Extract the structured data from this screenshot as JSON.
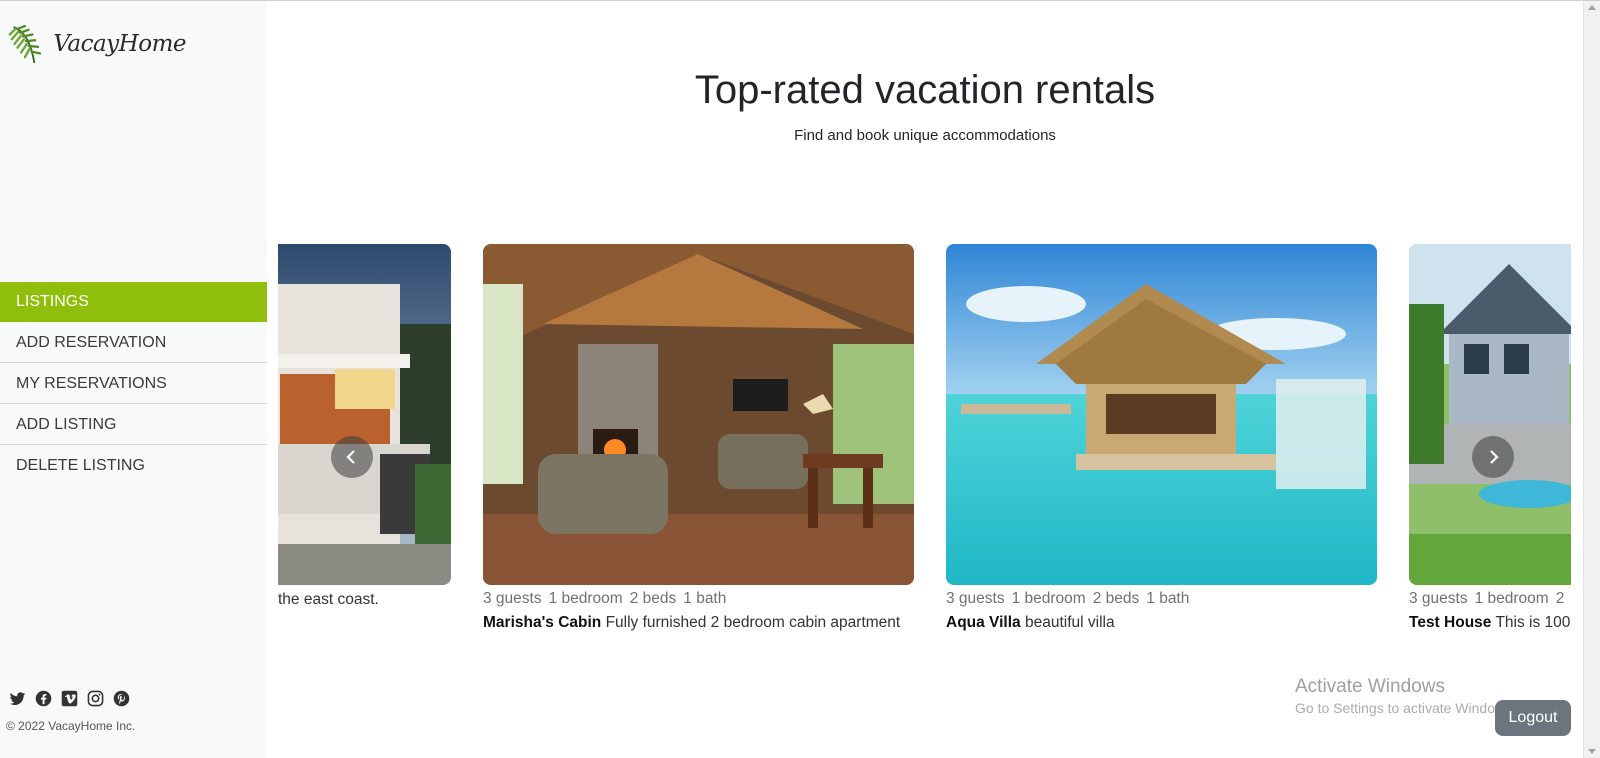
{
  "brand": {
    "name": "VacayHome"
  },
  "nav": [
    {
      "label": "LISTINGS",
      "active": true
    },
    {
      "label": "ADD RESERVATION",
      "active": false
    },
    {
      "label": "MY RESERVATIONS",
      "active": false
    },
    {
      "label": "ADD LISTING",
      "active": false
    },
    {
      "label": "DELETE LISTING",
      "active": false
    }
  ],
  "social": [
    "twitter-icon",
    "facebook-icon",
    "vimeo-icon",
    "instagram-icon",
    "pinterest-icon"
  ],
  "footer": {
    "copyright": "© 2022 VacayHome Inc."
  },
  "header": {
    "title": "Top-rated vacation rentals",
    "subtitle": "Find and book unique accommodations"
  },
  "listings": [
    {
      "meta": [],
      "name": "",
      "description": "the east coast."
    },
    {
      "meta": [
        "3 guests",
        "1 bedroom",
        "2 beds",
        "1 bath"
      ],
      "name": "Marisha's Cabin",
      "description": "Fully furnished 2 bedroom cabin apartment"
    },
    {
      "meta": [
        "3 guests",
        "1 bedroom",
        "2 beds",
        "1 bath"
      ],
      "name": "Aqua Villa",
      "description": "beautiful villa"
    },
    {
      "meta": [
        "3 guests",
        "1 bedroom",
        "2"
      ],
      "name": "Test House",
      "description": "This is 100"
    }
  ],
  "carousel": {
    "prev_icon": "chevron-left-icon",
    "next_icon": "chevron-right-icon"
  },
  "system": {
    "activate_title": "Activate Windows",
    "activate_sub": "Go to Settings to activate Windows."
  },
  "actions": {
    "logout": "Logout"
  },
  "colors": {
    "accent": "#8fbf0a",
    "sidebar_bg": "#f8f9fa",
    "logout_bg": "#6c757d"
  }
}
